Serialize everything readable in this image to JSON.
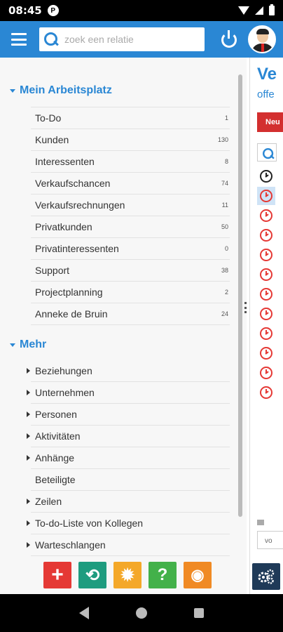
{
  "status_bar": {
    "time": "08:45",
    "app_icon_letter": "P"
  },
  "search": {
    "placeholder": "zoek een relatie"
  },
  "drawer": {
    "section1": {
      "title": "Mein Arbeitsplatz",
      "items": [
        {
          "label": "To-Do",
          "count": "1"
        },
        {
          "label": "Kunden",
          "count": "130"
        },
        {
          "label": "Interessenten",
          "count": "8"
        },
        {
          "label": "Verkaufschancen",
          "count": "74"
        },
        {
          "label": "Verkaufsrechnungen",
          "count": "11"
        },
        {
          "label": "Privatkunden",
          "count": "50"
        },
        {
          "label": "Privatinteressenten",
          "count": "0"
        },
        {
          "label": "Support",
          "count": "38"
        },
        {
          "label": "Projectplanning",
          "count": "2"
        },
        {
          "label": "Anneke de Bruin",
          "count": "24"
        }
      ]
    },
    "section2": {
      "title": "Mehr",
      "items": [
        {
          "label": "Beziehungen"
        },
        {
          "label": "Unternehmen"
        },
        {
          "label": "Personen"
        },
        {
          "label": "Aktivitäten"
        },
        {
          "label": "Anhänge"
        },
        {
          "label": "Beteiligte"
        },
        {
          "label": "Zeilen"
        },
        {
          "label": "To-do-Liste von Kollegen"
        },
        {
          "label": "Warteschlangen"
        }
      ]
    }
  },
  "toolbar": {
    "buttons": [
      {
        "name": "add",
        "color": "#e53935",
        "glyph": "+"
      },
      {
        "name": "history",
        "color": "#1e9c7f",
        "glyph": "⟲"
      },
      {
        "name": "settings",
        "color": "#f4a829",
        "glyph": "✹"
      },
      {
        "name": "help",
        "color": "#43b14a",
        "glyph": "?"
      },
      {
        "name": "rss",
        "color": "#f08a24",
        "glyph": "◉"
      }
    ]
  },
  "right_panel": {
    "title": "Ve",
    "subtitle": "offe",
    "new_button": "Neu",
    "footer_text": "vo"
  },
  "colors": {
    "accent": "#2a87d4",
    "drawer_bg": "#f7f7f7",
    "danger": "#d32f2f"
  }
}
